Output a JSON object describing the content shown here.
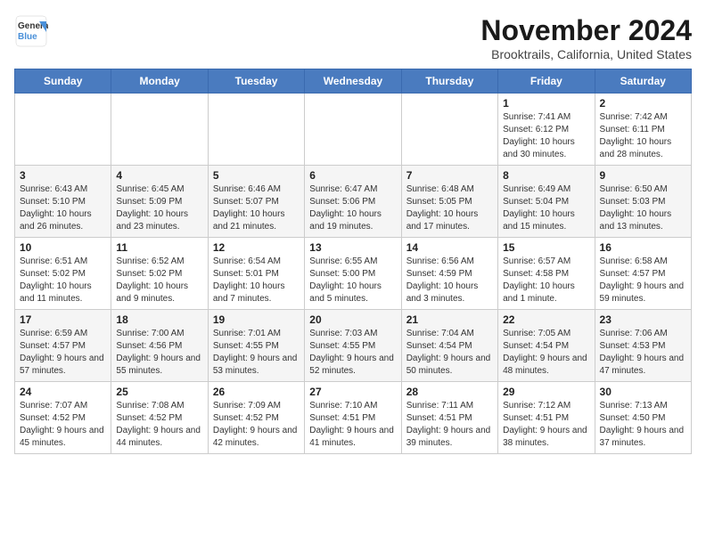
{
  "logo": {
    "line1": "General",
    "line2": "Blue"
  },
  "title": "November 2024",
  "subtitle": "Brooktrails, California, United States",
  "headers": [
    "Sunday",
    "Monday",
    "Tuesday",
    "Wednesday",
    "Thursday",
    "Friday",
    "Saturday"
  ],
  "weeks": [
    [
      {
        "day": "",
        "detail": ""
      },
      {
        "day": "",
        "detail": ""
      },
      {
        "day": "",
        "detail": ""
      },
      {
        "day": "",
        "detail": ""
      },
      {
        "day": "",
        "detail": ""
      },
      {
        "day": "1",
        "detail": "Sunrise: 7:41 AM\nSunset: 6:12 PM\nDaylight: 10 hours and 30 minutes."
      },
      {
        "day": "2",
        "detail": "Sunrise: 7:42 AM\nSunset: 6:11 PM\nDaylight: 10 hours and 28 minutes."
      }
    ],
    [
      {
        "day": "3",
        "detail": "Sunrise: 6:43 AM\nSunset: 5:10 PM\nDaylight: 10 hours and 26 minutes."
      },
      {
        "day": "4",
        "detail": "Sunrise: 6:45 AM\nSunset: 5:09 PM\nDaylight: 10 hours and 23 minutes."
      },
      {
        "day": "5",
        "detail": "Sunrise: 6:46 AM\nSunset: 5:07 PM\nDaylight: 10 hours and 21 minutes."
      },
      {
        "day": "6",
        "detail": "Sunrise: 6:47 AM\nSunset: 5:06 PM\nDaylight: 10 hours and 19 minutes."
      },
      {
        "day": "7",
        "detail": "Sunrise: 6:48 AM\nSunset: 5:05 PM\nDaylight: 10 hours and 17 minutes."
      },
      {
        "day": "8",
        "detail": "Sunrise: 6:49 AM\nSunset: 5:04 PM\nDaylight: 10 hours and 15 minutes."
      },
      {
        "day": "9",
        "detail": "Sunrise: 6:50 AM\nSunset: 5:03 PM\nDaylight: 10 hours and 13 minutes."
      }
    ],
    [
      {
        "day": "10",
        "detail": "Sunrise: 6:51 AM\nSunset: 5:02 PM\nDaylight: 10 hours and 11 minutes."
      },
      {
        "day": "11",
        "detail": "Sunrise: 6:52 AM\nSunset: 5:02 PM\nDaylight: 10 hours and 9 minutes."
      },
      {
        "day": "12",
        "detail": "Sunrise: 6:54 AM\nSunset: 5:01 PM\nDaylight: 10 hours and 7 minutes."
      },
      {
        "day": "13",
        "detail": "Sunrise: 6:55 AM\nSunset: 5:00 PM\nDaylight: 10 hours and 5 minutes."
      },
      {
        "day": "14",
        "detail": "Sunrise: 6:56 AM\nSunset: 4:59 PM\nDaylight: 10 hours and 3 minutes."
      },
      {
        "day": "15",
        "detail": "Sunrise: 6:57 AM\nSunset: 4:58 PM\nDaylight: 10 hours and 1 minute."
      },
      {
        "day": "16",
        "detail": "Sunrise: 6:58 AM\nSunset: 4:57 PM\nDaylight: 9 hours and 59 minutes."
      }
    ],
    [
      {
        "day": "17",
        "detail": "Sunrise: 6:59 AM\nSunset: 4:57 PM\nDaylight: 9 hours and 57 minutes."
      },
      {
        "day": "18",
        "detail": "Sunrise: 7:00 AM\nSunset: 4:56 PM\nDaylight: 9 hours and 55 minutes."
      },
      {
        "day": "19",
        "detail": "Sunrise: 7:01 AM\nSunset: 4:55 PM\nDaylight: 9 hours and 53 minutes."
      },
      {
        "day": "20",
        "detail": "Sunrise: 7:03 AM\nSunset: 4:55 PM\nDaylight: 9 hours and 52 minutes."
      },
      {
        "day": "21",
        "detail": "Sunrise: 7:04 AM\nSunset: 4:54 PM\nDaylight: 9 hours and 50 minutes."
      },
      {
        "day": "22",
        "detail": "Sunrise: 7:05 AM\nSunset: 4:54 PM\nDaylight: 9 hours and 48 minutes."
      },
      {
        "day": "23",
        "detail": "Sunrise: 7:06 AM\nSunset: 4:53 PM\nDaylight: 9 hours and 47 minutes."
      }
    ],
    [
      {
        "day": "24",
        "detail": "Sunrise: 7:07 AM\nSunset: 4:52 PM\nDaylight: 9 hours and 45 minutes."
      },
      {
        "day": "25",
        "detail": "Sunrise: 7:08 AM\nSunset: 4:52 PM\nDaylight: 9 hours and 44 minutes."
      },
      {
        "day": "26",
        "detail": "Sunrise: 7:09 AM\nSunset: 4:52 PM\nDaylight: 9 hours and 42 minutes."
      },
      {
        "day": "27",
        "detail": "Sunrise: 7:10 AM\nSunset: 4:51 PM\nDaylight: 9 hours and 41 minutes."
      },
      {
        "day": "28",
        "detail": "Sunrise: 7:11 AM\nSunset: 4:51 PM\nDaylight: 9 hours and 39 minutes."
      },
      {
        "day": "29",
        "detail": "Sunrise: 7:12 AM\nSunset: 4:51 PM\nDaylight: 9 hours and 38 minutes."
      },
      {
        "day": "30",
        "detail": "Sunrise: 7:13 AM\nSunset: 4:50 PM\nDaylight: 9 hours and 37 minutes."
      }
    ]
  ]
}
